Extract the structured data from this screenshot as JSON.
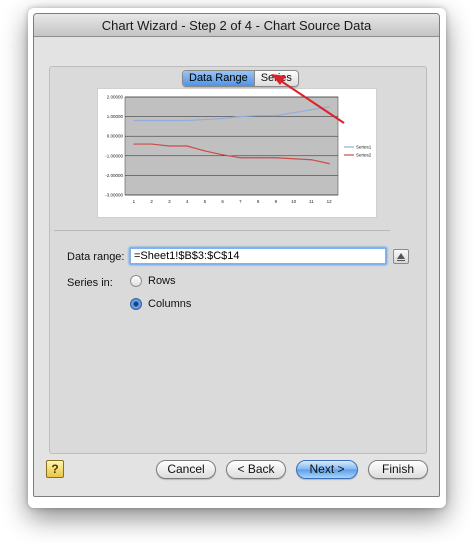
{
  "window": {
    "title": "Chart Wizard - Step 2 of 4 - Chart Source Data"
  },
  "tabs": [
    {
      "label": "Data Range",
      "active": true
    },
    {
      "label": "Series",
      "active": false
    }
  ],
  "chart_data": {
    "type": "line",
    "title": "",
    "categories": [
      "1",
      "2",
      "3",
      "4",
      "5",
      "6",
      "7",
      "8",
      "9",
      "10",
      "11",
      "12"
    ],
    "series": [
      {
        "name": "Series1",
        "color": "#8faedc",
        "values": [
          0.8,
          0.8,
          0.8,
          0.8,
          0.85,
          0.9,
          1.0,
          1.05,
          1.05,
          1.2,
          1.35,
          1.5
        ]
      },
      {
        "name": "Series2",
        "color": "#cc4b4b",
        "values": [
          -0.4,
          -0.4,
          -0.5,
          -0.5,
          -0.75,
          -0.95,
          -1.1,
          -1.1,
          -1.1,
          -1.15,
          -1.2,
          -1.4
        ]
      }
    ],
    "y_ticks": [
      "2.00000",
      "1.00000",
      "0.00000",
      "-1.00000",
      "-2.00000",
      "-3.00000"
    ],
    "ylim": [
      -3,
      2
    ],
    "legend_position": "right",
    "plot_background": "#c0c0c0",
    "grid": true
  },
  "form": {
    "data_range_label": "Data range:",
    "data_range_value": "=Sheet1!$B$3:$C$14",
    "series_in_label": "Series in:",
    "options": [
      {
        "label": "Rows",
        "selected": false
      },
      {
        "label": "Columns",
        "selected": true
      }
    ]
  },
  "buttons": {
    "help": "?",
    "cancel": "Cancel",
    "back": "< Back",
    "next": "Next >",
    "finish": "Finish"
  },
  "annotation": {
    "arrow_color": "#d9232d",
    "points_to": "Series"
  }
}
